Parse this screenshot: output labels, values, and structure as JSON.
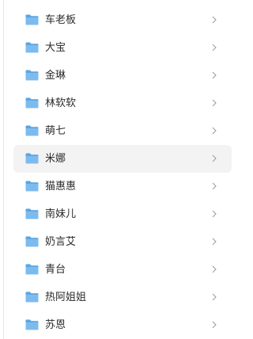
{
  "folders": [
    {
      "label": "车老板",
      "selected": false
    },
    {
      "label": "大宝",
      "selected": false
    },
    {
      "label": "金琳",
      "selected": false
    },
    {
      "label": "林软软",
      "selected": false
    },
    {
      "label": "萌七",
      "selected": false
    },
    {
      "label": "米娜",
      "selected": true
    },
    {
      "label": "猫惠惠",
      "selected": false
    },
    {
      "label": "南妹儿",
      "selected": false
    },
    {
      "label": "奶言艾",
      "selected": false
    },
    {
      "label": "青台",
      "selected": false
    },
    {
      "label": "热阿姐姐",
      "selected": false
    },
    {
      "label": "苏恩",
      "selected": false
    }
  ],
  "colors": {
    "folder_icon": "#5aa5e3",
    "folder_icon_tab": "#7dbbef",
    "chevron": "#9a9a9a",
    "selected_bg": "#f3f3f3",
    "text": "#2b2b2b"
  },
  "icons": {
    "folder": "folder-icon",
    "chevron": "chevron-right-icon"
  }
}
